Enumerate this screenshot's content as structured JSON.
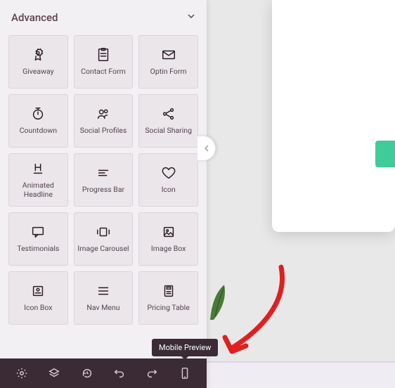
{
  "section": {
    "title": "Advanced"
  },
  "widgets": [
    {
      "label": "Giveaway",
      "icon": "badge"
    },
    {
      "label": "Contact Form",
      "icon": "form"
    },
    {
      "label": "Optin Form",
      "icon": "mail"
    },
    {
      "label": "Countdown",
      "icon": "timer"
    },
    {
      "label": "Social Profiles",
      "icon": "people"
    },
    {
      "label": "Social Sharing",
      "icon": "share"
    },
    {
      "label": "Animated Headline",
      "icon": "headline"
    },
    {
      "label": "Progress Bar",
      "icon": "progress"
    },
    {
      "label": "Icon",
      "icon": "heart"
    },
    {
      "label": "Testimonials",
      "icon": "chat"
    },
    {
      "label": "Image Carousel",
      "icon": "carousel"
    },
    {
      "label": "Image Box",
      "icon": "imagebox"
    },
    {
      "label": "Icon Box",
      "icon": "iconbox"
    },
    {
      "label": "Nav Menu",
      "icon": "menu"
    },
    {
      "label": "Pricing Table",
      "icon": "pricing"
    }
  ],
  "tooltip": {
    "text": "Mobile Preview"
  },
  "toolbar": {
    "items": [
      "settings",
      "layers",
      "history",
      "undo",
      "redo",
      "mobile"
    ]
  }
}
